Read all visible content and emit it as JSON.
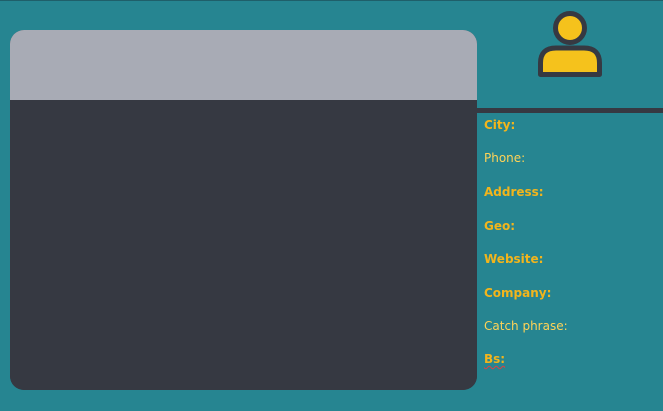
{
  "profile": {
    "avatar_icon": "user-icon",
    "fields": [
      {
        "label": "City:"
      },
      {
        "label": "Phone:"
      },
      {
        "label": "Address:"
      },
      {
        "label": "Geo:"
      },
      {
        "label": "Website:"
      },
      {
        "label": "Company:"
      },
      {
        "label": "Catch phrase:"
      },
      {
        "label": "Bs:"
      }
    ]
  },
  "colors": {
    "background": "#268591",
    "panel_dark": "#363942",
    "panel_header": "#a8abb5",
    "accent": "#f2b51c"
  }
}
